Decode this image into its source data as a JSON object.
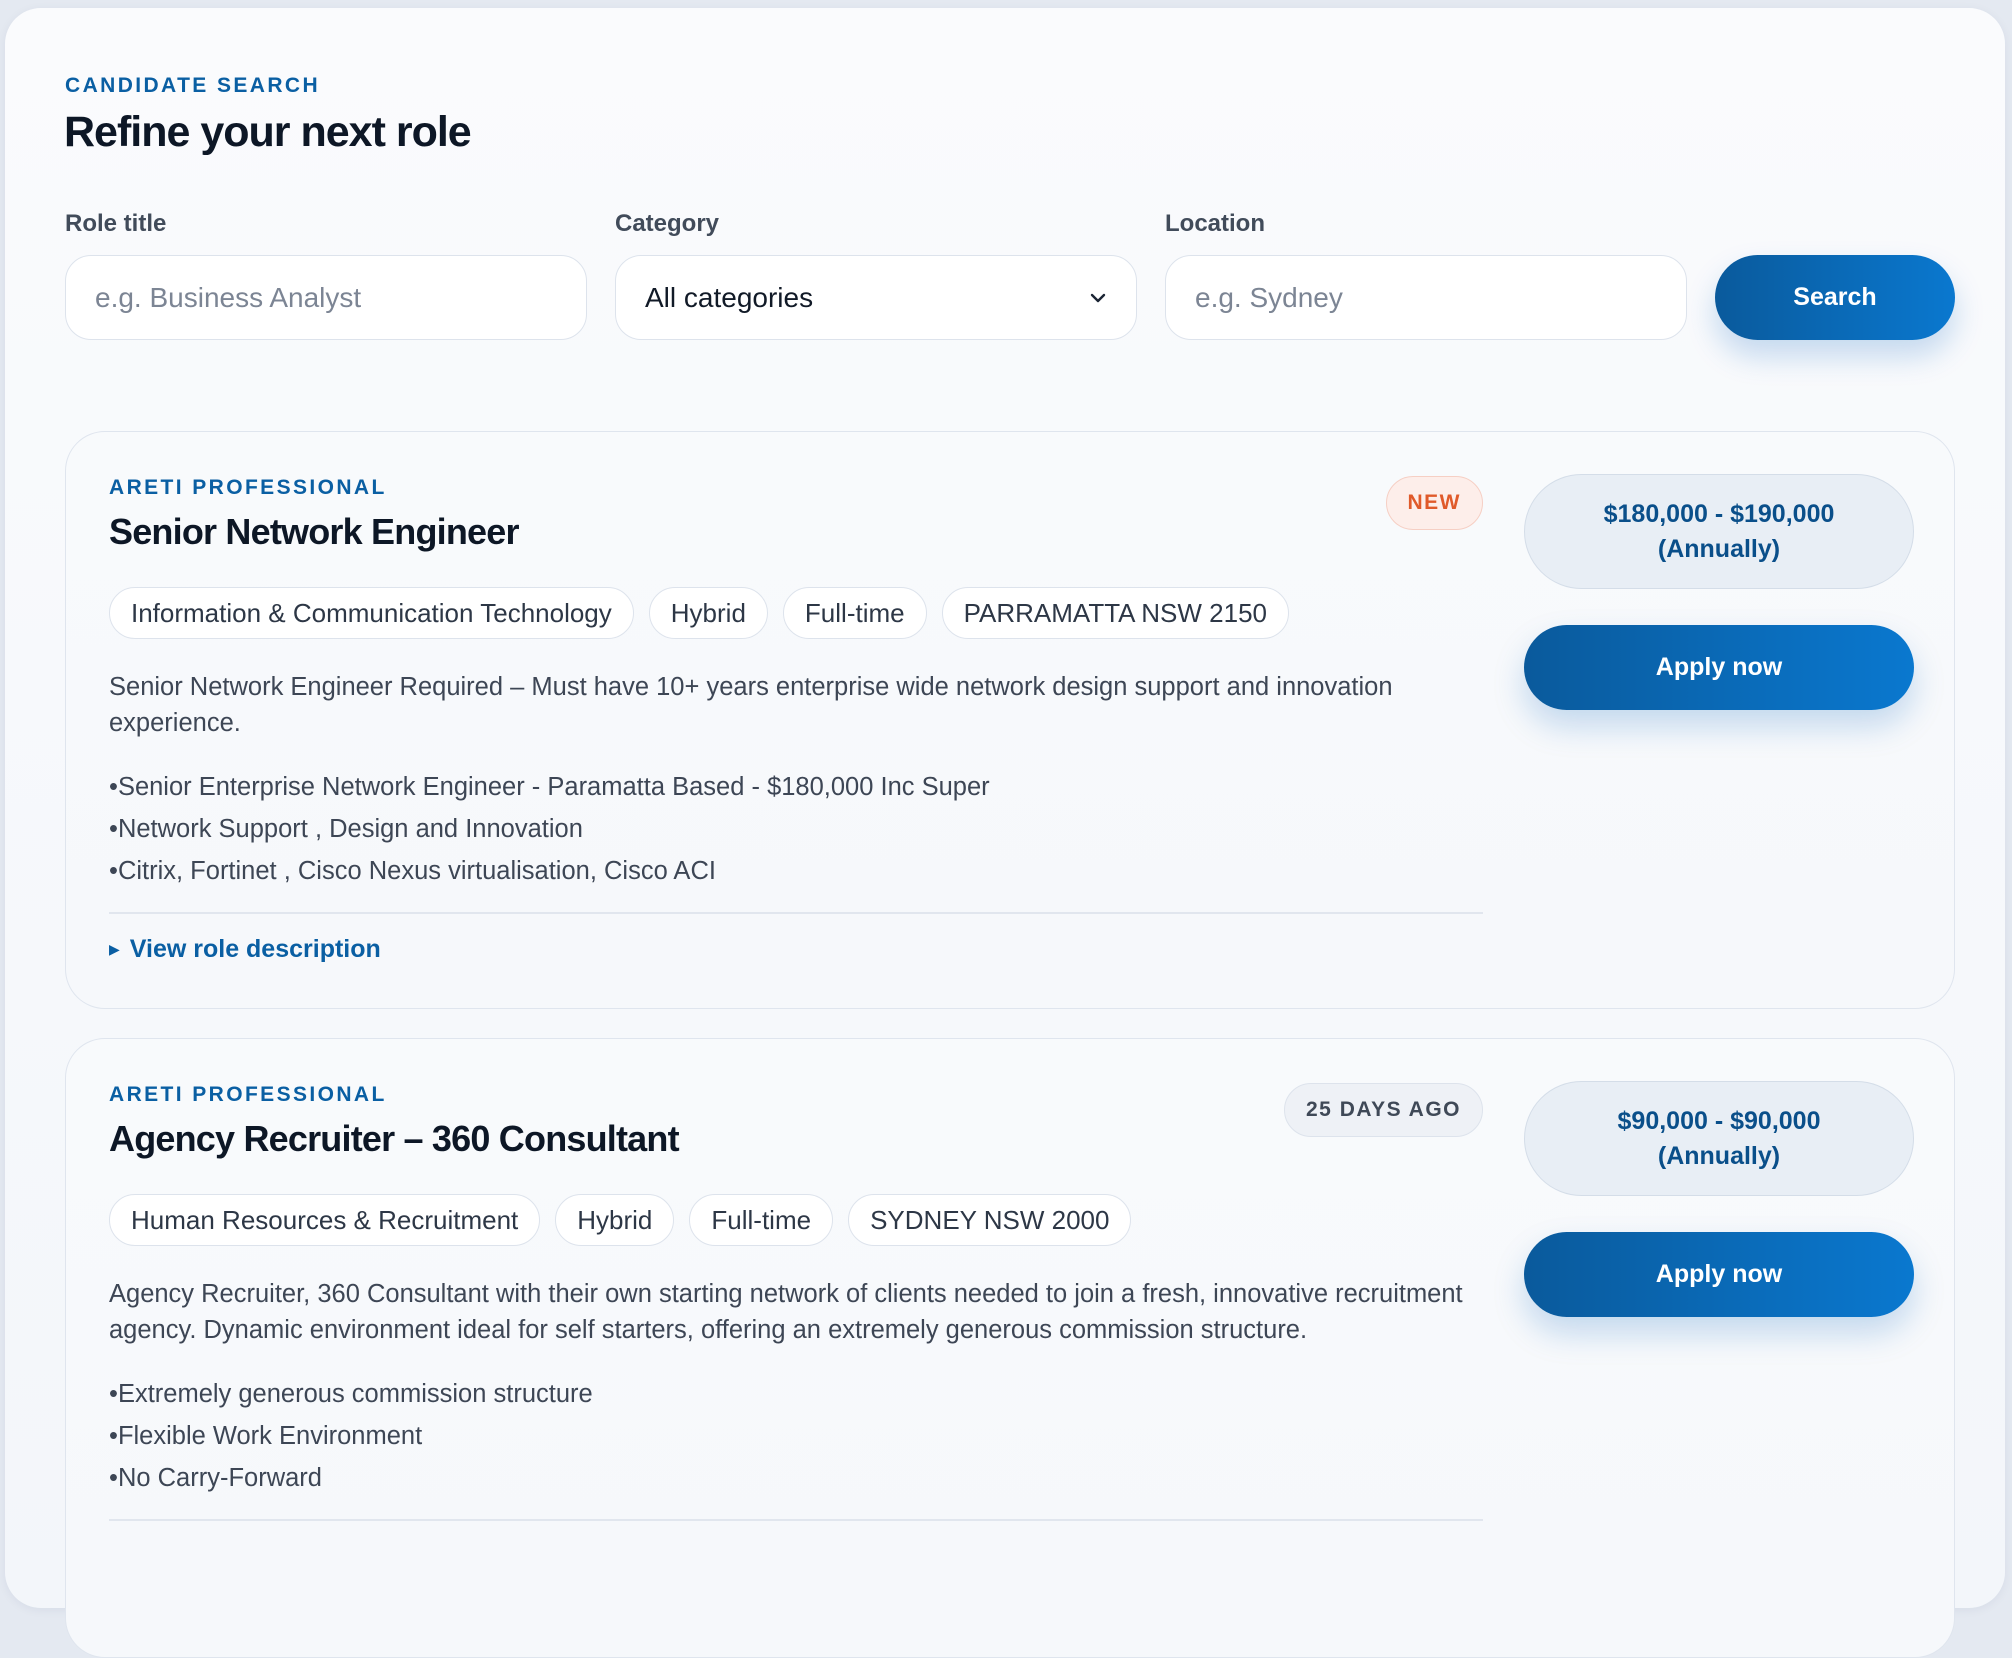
{
  "header": {
    "eyebrow": "CANDIDATE SEARCH",
    "title": "Refine your next role"
  },
  "search": {
    "role_label": "Role title",
    "role_placeholder": "e.g. Business Analyst",
    "category_label": "Category",
    "category_value": "All categories",
    "location_label": "Location",
    "location_placeholder": "e.g. Sydney",
    "button_label": "Search"
  },
  "colors": {
    "accent": "#0a5fa3",
    "button_gradient_start": "#0a5a9c",
    "button_gradient_end": "#0a78cf",
    "new_badge": "#e05a2a"
  },
  "jobs": [
    {
      "company": "ARETI PROFESSIONAL",
      "title": "Senior Network Engineer",
      "badge": "NEW",
      "tags": [
        "Information & Communication Technology",
        "Hybrid",
        "Full-time",
        "PARRAMATTA NSW 2150"
      ],
      "summary": "Senior Network Engineer Required – Must have 10+ years enterprise wide network design support and innovation experience.",
      "bullets": [
        "Senior Enterprise Network Engineer - Paramatta Based - $180,000 Inc Super",
        "Network Support , Design and Innovation",
        "Citrix, Fortinet , Cisco Nexus virtualisation, Cisco ACI"
      ],
      "details_label": "View role description",
      "salary_range": "$180,000 - $190,000",
      "salary_period": "(Annually)",
      "apply_label": "Apply now"
    },
    {
      "company": "ARETI PROFESSIONAL",
      "title": "Agency Recruiter – 360 Consultant",
      "badge": "25 DAYS AGO",
      "tags": [
        "Human Resources & Recruitment",
        "Hybrid",
        "Full-time",
        "SYDNEY NSW 2000"
      ],
      "summary": "Agency Recruiter, 360 Consultant with their own starting network of clients needed to join a fresh, innovative recruitment agency. Dynamic environment ideal for self starters, offering an extremely generous commission structure.",
      "bullets": [
        "Extremely generous commission structure",
        "Flexible Work Environment",
        "No Carry-Forward"
      ],
      "salary_range": "$90,000 - $90,000",
      "salary_period": "(Annually)",
      "apply_label": "Apply now"
    }
  ]
}
